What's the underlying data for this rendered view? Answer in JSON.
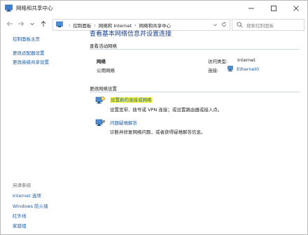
{
  "window": {
    "title": "网络和共享中心",
    "minimize_icon": "minimize-icon",
    "maximize_icon": "maximize-icon",
    "close_icon": "close-icon"
  },
  "address_bar": {
    "crumbs": [
      "控制面板",
      "网络和 Internet",
      "网络和共享中心"
    ],
    "search_placeholder": "搜索控制面板"
  },
  "left_pane": {
    "links": [
      "控制面板主页",
      "更改适配器设置",
      "更改高级共享设置"
    ],
    "see_also_label": "另请参阅",
    "see_also_links": [
      "Internet 选项",
      "Windows 防火墙",
      "红外线",
      "家庭组"
    ]
  },
  "main": {
    "heading": "查看基本网络信息并设置连接",
    "active_networks_label": "查看活动网络",
    "network_name": "网络",
    "network_type": "公用网络",
    "access_type_label": "访问类型:",
    "access_type_value": "Internet",
    "connections_label": "连接:",
    "connection_value": "Ethernet0",
    "change_settings_label": "更改网络设置",
    "setup_link": "设置新的连接或网络",
    "setup_desc": "设置宽带、拨号或 VPN 连接；或设置路由器或接入点。",
    "troubleshoot_link": "问题疑难解答",
    "troubleshoot_desc": "诊断并修复网络问题，或者获得疑难解答信息。"
  },
  "colors": {
    "link_blue": "#1a5aa8",
    "heading_blue": "#1a3f8a",
    "highlight_yellow": "#fbfb3a"
  }
}
